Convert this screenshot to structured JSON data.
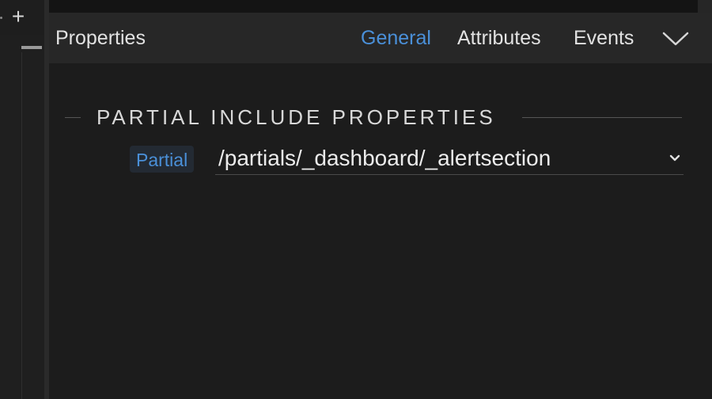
{
  "left_panel": {
    "add_icon": "plus-icon"
  },
  "header": {
    "title": "Properties",
    "tabs": [
      {
        "label": "General",
        "active": true
      },
      {
        "label": "Attributes",
        "active": false
      },
      {
        "label": "Events",
        "active": false
      }
    ],
    "collapse_icon": "chevron-down-icon"
  },
  "section": {
    "title": "PARTIAL INCLUDE PROPERTIES",
    "fields": [
      {
        "label": "Partial",
        "value": "/partials/_dashboard/_alertsection",
        "control": "select"
      }
    ]
  },
  "colors": {
    "accent": "#4a90d9",
    "background": "#1c1c1c",
    "header_bg": "#272727",
    "text": "#e2e2e2"
  }
}
